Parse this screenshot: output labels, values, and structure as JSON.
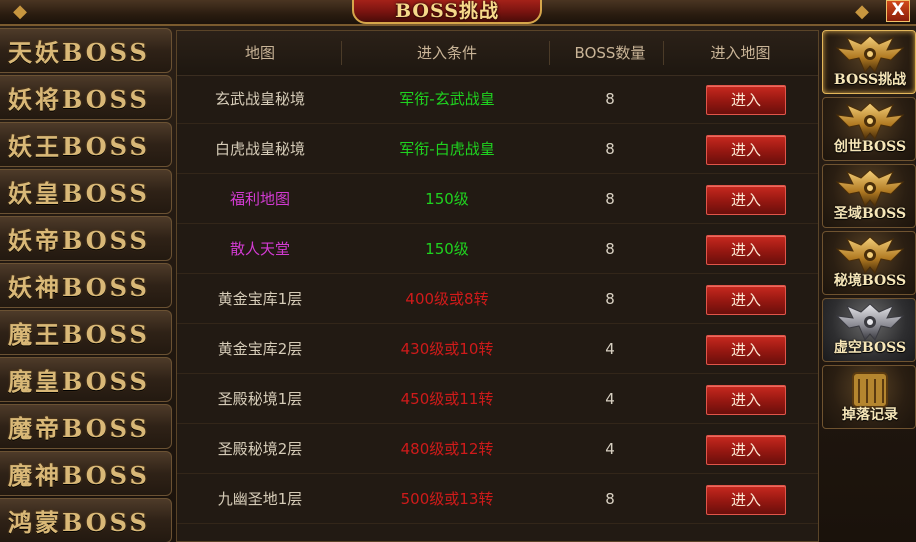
{
  "window": {
    "title": "BOSS挑战",
    "close_label": "X"
  },
  "left_nav": [
    {
      "label": "天妖BOSS"
    },
    {
      "label": "妖将BOSS"
    },
    {
      "label": "妖王BOSS"
    },
    {
      "label": "妖皇BOSS"
    },
    {
      "label": "妖帝BOSS"
    },
    {
      "label": "妖神BOSS"
    },
    {
      "label": "魔王BOSS"
    },
    {
      "label": "魔皇BOSS"
    },
    {
      "label": "魔帝BOSS"
    },
    {
      "label": "魔神BOSS"
    },
    {
      "label": "鸿蒙BOSS"
    }
  ],
  "table": {
    "headers": {
      "map": "地图",
      "condition": "进入条件",
      "count": "BOSS数量",
      "enter": "进入地图"
    },
    "rows": [
      {
        "map": "玄武战皇秘境",
        "condition": "军衔-玄武战皇",
        "count": "8",
        "button": "进入",
        "map_color": "#d6ccb8",
        "cond_color": "#1fd31f"
      },
      {
        "map": "白虎战皇秘境",
        "condition": "军衔-白虎战皇",
        "count": "8",
        "button": "进入",
        "map_color": "#d6ccb8",
        "cond_color": "#1fd31f"
      },
      {
        "map": "福利地图",
        "condition": "150级",
        "count": "8",
        "button": "进入",
        "map_color": "#d23bd2",
        "cond_color": "#1fd31f"
      },
      {
        "map": "散人天堂",
        "condition": "150级",
        "count": "8",
        "button": "进入",
        "map_color": "#d23bd2",
        "cond_color": "#1fd31f"
      },
      {
        "map": "黄金宝库1层",
        "condition": "400级或8转",
        "count": "8",
        "button": "进入",
        "map_color": "#d6ccb8",
        "cond_color": "#d01a1a"
      },
      {
        "map": "黄金宝库2层",
        "condition": "430级或10转",
        "count": "4",
        "button": "进入",
        "map_color": "#d6ccb8",
        "cond_color": "#d01a1a"
      },
      {
        "map": "圣殿秘境1层",
        "condition": "450级或11转",
        "count": "4",
        "button": "进入",
        "map_color": "#d6ccb8",
        "cond_color": "#d01a1a"
      },
      {
        "map": "圣殿秘境2层",
        "condition": "480级或12转",
        "count": "4",
        "button": "进入",
        "map_color": "#d6ccb8",
        "cond_color": "#d01a1a"
      },
      {
        "map": "九幽圣地1层",
        "condition": "500级或13转",
        "count": "8",
        "button": "进入",
        "map_color": "#d6ccb8",
        "cond_color": "#d01a1a"
      }
    ]
  },
  "right_nav": [
    {
      "label": "BOSS挑战",
      "icon": "demon-crest-icon",
      "active": true,
      "tone": "gold"
    },
    {
      "label": "创世BOSS",
      "icon": "demon-crest-icon",
      "active": false,
      "tone": "gold"
    },
    {
      "label": "圣域BOSS",
      "icon": "demon-crest-icon",
      "active": false,
      "tone": "gold"
    },
    {
      "label": "秘境BOSS",
      "icon": "demon-crest-icon",
      "active": false,
      "tone": "gold"
    },
    {
      "label": "虚空BOSS",
      "icon": "demon-crest-icon",
      "active": false,
      "tone": "silver"
    },
    {
      "label": "掉落记录",
      "icon": "scroll-icon",
      "active": false,
      "tone": "gold"
    }
  ]
}
